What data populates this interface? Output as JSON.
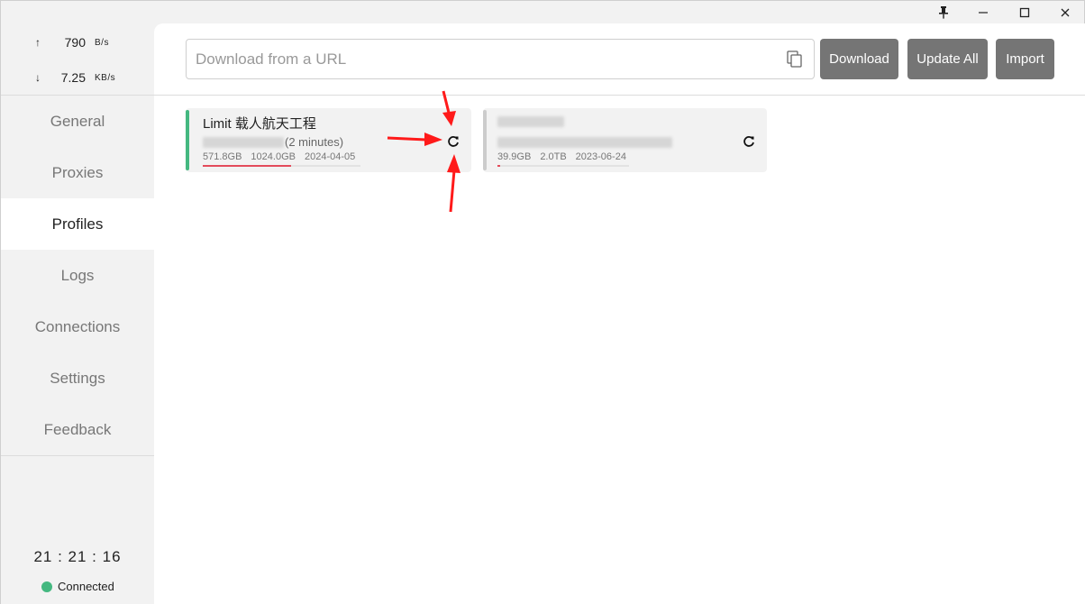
{
  "window": {
    "controls": {
      "pin": "pin-icon",
      "minimize": "minimize-icon",
      "maximize": "maximize-icon",
      "close": "close-icon"
    }
  },
  "traffic": {
    "up": {
      "arrow": "↑",
      "value": "790",
      "unit": "B/s"
    },
    "down": {
      "arrow": "↓",
      "value": "7.25",
      "unit": "KB/s"
    }
  },
  "sidebar": {
    "items": [
      {
        "label": "General"
      },
      {
        "label": "Proxies"
      },
      {
        "label": "Profiles"
      },
      {
        "label": "Logs"
      },
      {
        "label": "Connections"
      },
      {
        "label": "Settings"
      },
      {
        "label": "Feedback"
      }
    ],
    "active": "Profiles",
    "clock": "21 : 21 : 16",
    "status": "Connected"
  },
  "toolbar": {
    "url_placeholder": "Download from a URL",
    "download_label": "Download",
    "update_all_label": "Update All",
    "import_label": "Import"
  },
  "profiles": [
    {
      "name": "Limit 载人航天工程",
      "updated": "(2 minutes)",
      "used": "571.8GB",
      "total": "1024.0GB",
      "expire": "2024-04-05",
      "usage_fraction": 0.56,
      "active": true
    },
    {
      "name": "",
      "updated": "",
      "used": "39.9GB",
      "total": "2.0TB",
      "expire": "2023-06-24",
      "usage_fraction": 0.02,
      "active": false
    }
  ],
  "colors": {
    "active_bar": "#44b880",
    "progress": "#e34b5b",
    "button": "#757575",
    "annotation": "#ff0000"
  }
}
